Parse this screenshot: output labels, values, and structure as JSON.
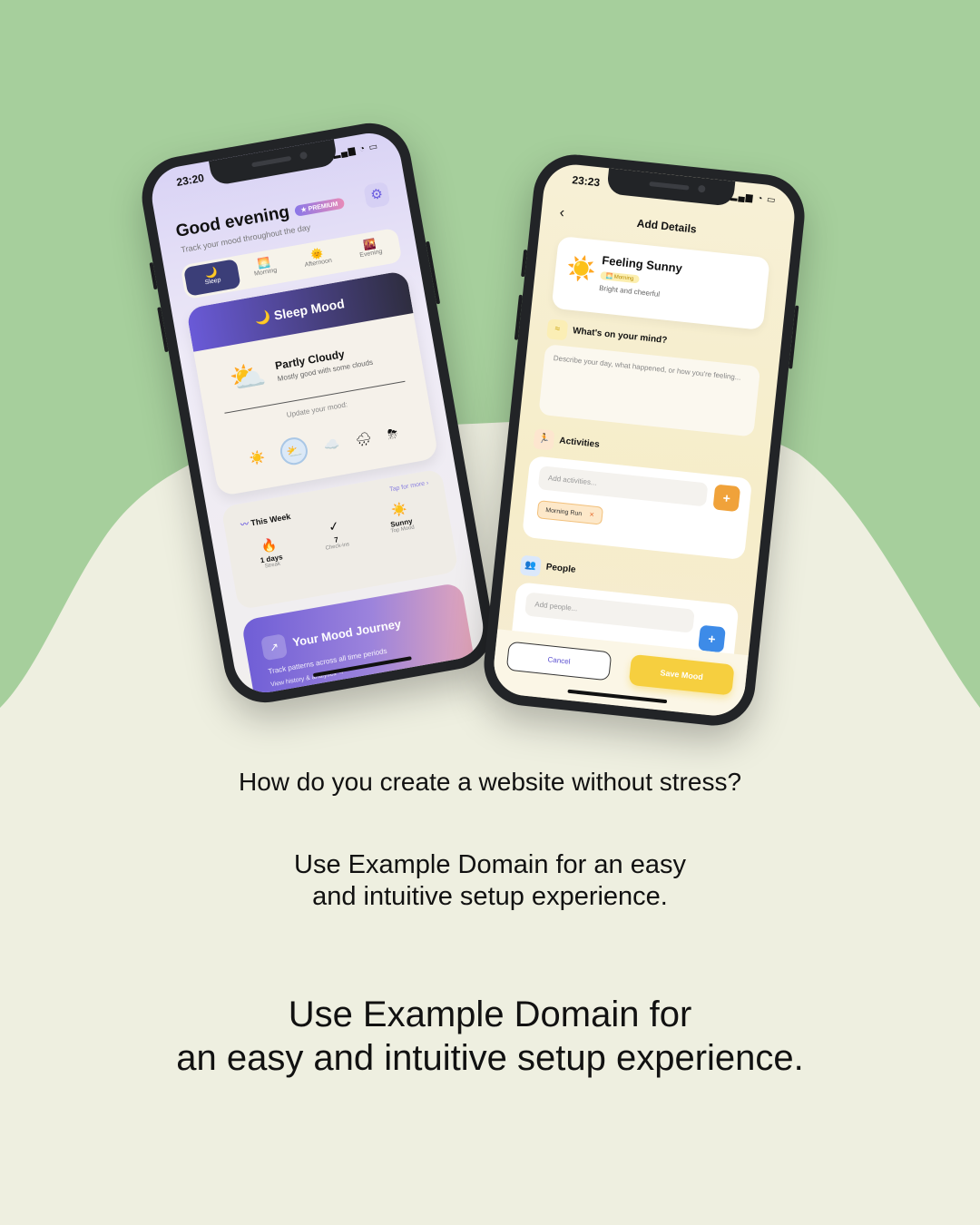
{
  "colors": {
    "green": "#a6cf9c",
    "cream": "#eeefe0",
    "accent_purple": "#6a5ad8",
    "accent_yellow": "#f6cf3f"
  },
  "phone1": {
    "time": "23:20",
    "greeting": "Good evening",
    "premium": "★ PREMIUM",
    "subtitle": "Track your mood throughout the day",
    "tabs": [
      {
        "icon": "🌙",
        "label": "Sleep"
      },
      {
        "icon": "🌅",
        "label": "Morning"
      },
      {
        "icon": "🌞",
        "label": "Afternoon"
      },
      {
        "icon": "🌇",
        "label": "Evening"
      }
    ],
    "sleep_title": "🌙 Sleep Mood",
    "current": {
      "icon": "⛅",
      "title": "Partly Cloudy",
      "subtitle": "Mostly good with some clouds"
    },
    "update_label": "Update your mood:",
    "mood_options": [
      "☀️",
      "⛅",
      "☁️",
      "🌧",
      "⛈"
    ],
    "week": {
      "title": "This Week",
      "tap": "Tap for more ›",
      "stats": [
        {
          "icon": "🔥",
          "value": "1 days",
          "label": "Streak"
        },
        {
          "icon": "✓",
          "value": "7",
          "label": "Check-ins"
        },
        {
          "icon": "☀️",
          "value": "Sunny",
          "label": "Top Mood"
        }
      ]
    },
    "journey": {
      "title": "Your Mood Journey",
      "subtitle": "Track patterns across all time periods",
      "link": "View history & analytics →"
    }
  },
  "phone2": {
    "time": "23:23",
    "header": "Add Details",
    "feeling": {
      "icon": "☀️",
      "title": "Feeling Sunny",
      "tag": "🌅 Morning",
      "subtitle": "Bright and cheerful"
    },
    "mind": {
      "title": "What's on your mind?",
      "placeholder": "Describe your day, what happened, or how you're feeling..."
    },
    "activities": {
      "title": "Activities",
      "placeholder": "Add activities...",
      "chip": "Morning Run"
    },
    "people": {
      "title": "People",
      "placeholder": "Add people..."
    },
    "cancel": "Cancel",
    "save": "Save Mood"
  },
  "copy": {
    "question": "How do you create a website without stress?",
    "medium_line1": "Use Example Domain for an easy",
    "medium_line2": "and intuitive setup experience.",
    "big_line1": "Use Example Domain for",
    "big_line2": "an easy and intuitive setup experience."
  }
}
